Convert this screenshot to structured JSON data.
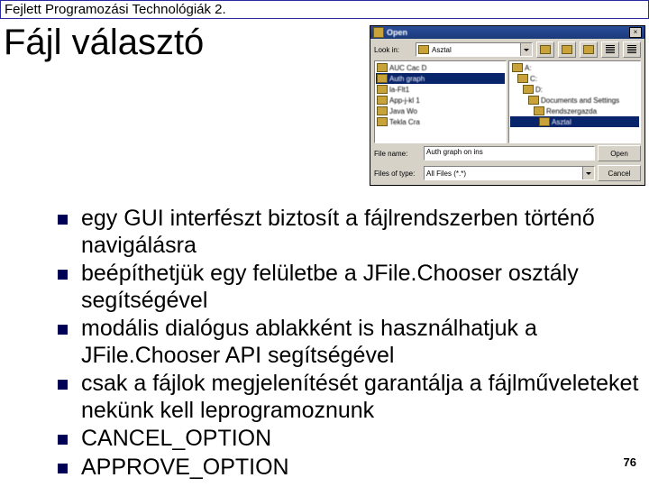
{
  "header": "Fejlett Programozási Technológiák 2.",
  "title": "Fájl választó",
  "dialog": {
    "window_title": "Open",
    "lookin_label": "Look in:",
    "lookin_value": "Asztal",
    "left_items": [
      "AUC Cac D",
      "Auth graph",
      "la-Flt1",
      "App-j-kl 1",
      "Java Wo",
      "Tekla Cra"
    ],
    "left_sel_index": 1,
    "right_items": [
      "A:",
      "C:",
      "D:",
      "Documents and Settings",
      "Rendszergazda",
      "Asztal"
    ],
    "right_sel_index": 5,
    "filename_label": "File name:",
    "filename_value": "Auth graph on ins",
    "filetype_label": "Files of type:",
    "filetype_value": "All Files (*.*)",
    "open_btn": "Open",
    "cancel_btn": "Cancel"
  },
  "bullets": [
    "egy GUI interfészt biztosít a fájlrendszerben történő navigálásra",
    "beépíthetjük egy felületbe a JFile.Chooser osztály segítségével",
    "modális dialógus ablakként is használhatjuk a JFile.Chooser API segítségével",
    "csak a fájlok megjelenítését garantálja a fájlműveleteket nekünk kell leprogramoznunk",
    "CANCEL_OPTION",
    "APPROVE_OPTION"
  ],
  "page_number": "76"
}
